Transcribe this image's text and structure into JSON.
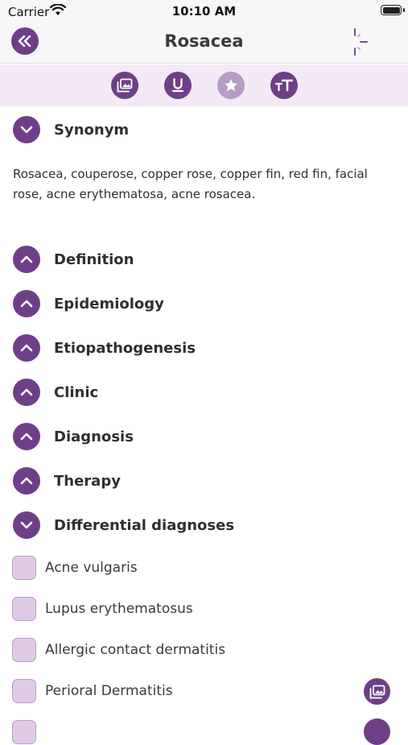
{
  "status_bar": {
    "carrier": "Carrier",
    "time": "10:10 AM"
  },
  "nav": {
    "title": "Rosacea"
  },
  "toolbar": {
    "buttons": [
      {
        "icon": "image-gallery-icon"
      },
      {
        "icon": "underline-icon"
      },
      {
        "icon": "star-icon",
        "state": "dimmed"
      },
      {
        "icon": "text-size-icon"
      }
    ]
  },
  "colors": {
    "accent": "#6e3f87",
    "toolbar_bg": "#f4e9f6",
    "checkbox_fill": "#e0cbe6"
  },
  "synonym": {
    "label": "Synonym",
    "expanded": true,
    "text": "Rosacea, couperose, copper rose, copper fin, red fin, facial rose, acne erythematosa, acne rosacea."
  },
  "sections": [
    {
      "label": "Definition",
      "expanded": false
    },
    {
      "label": "Epidemiology",
      "expanded": false
    },
    {
      "label": "Etiopathogenesis",
      "expanded": false
    },
    {
      "label": "Clinic",
      "expanded": false
    },
    {
      "label": "Diagnosis",
      "expanded": false
    },
    {
      "label": "Therapy",
      "expanded": false
    }
  ],
  "differential": {
    "label": "Differential diagnoses",
    "expanded": true,
    "items": [
      {
        "label": "Acne vulgaris",
        "checked": false
      },
      {
        "label": "Lupus erythematosus",
        "checked": false
      },
      {
        "label": "Allergic contact dermatitis",
        "checked": false
      },
      {
        "label": "Perioral Dermatitis",
        "checked": false,
        "has_image": true
      }
    ]
  }
}
